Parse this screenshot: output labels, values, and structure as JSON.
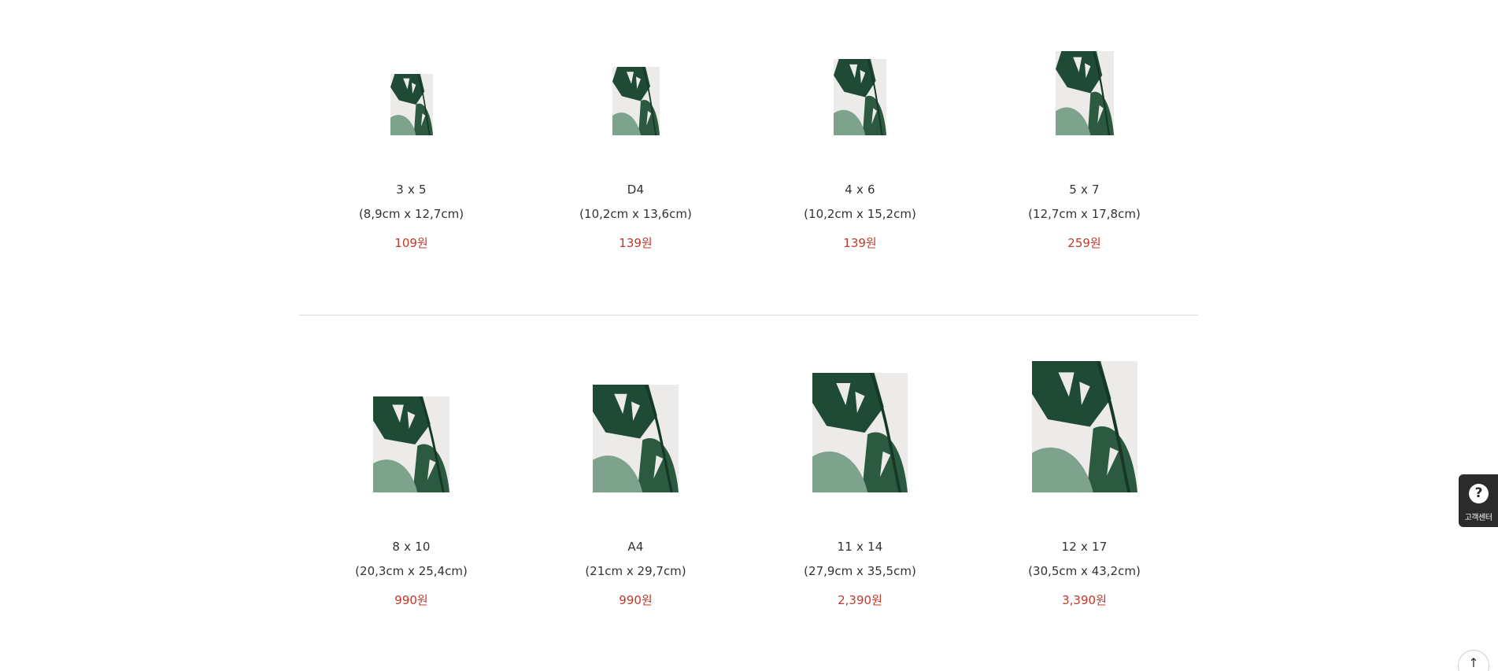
{
  "products_row1": [
    {
      "name": "3 x 5",
      "dimensions": "(8,9cm x 12,7cm)",
      "price": "109원"
    },
    {
      "name": "D4",
      "dimensions": "(10,2cm x 13,6cm)",
      "price": "139원"
    },
    {
      "name": "4 x 6",
      "dimensions": "(10,2cm x 15,2cm)",
      "price": "139원"
    },
    {
      "name": "5 x 7",
      "dimensions": "(12,7cm x 17,8cm)",
      "price": "259원"
    }
  ],
  "products_row2": [
    {
      "name": "8 x 10",
      "dimensions": "(20,3cm x 25,4cm)",
      "price": "990원"
    },
    {
      "name": "A4",
      "dimensions": "(21cm x 29,7cm)",
      "price": "990원"
    },
    {
      "name": "11 x 14",
      "dimensions": "(27,9cm x 35,5cm)",
      "price": "2,390원"
    },
    {
      "name": "12 x 17",
      "dimensions": "(30,5cm x 43,2cm)",
      "price": "3,390원"
    }
  ],
  "customer_center": {
    "icon": "question-icon",
    "symbol": "?",
    "label": "고객센터"
  },
  "scroll_top": {
    "icon": "arrow-up-icon",
    "symbol": "↑"
  },
  "colors": {
    "price": "#c0392b",
    "leaf_dark": "#1f4a36",
    "leaf_light": "#6f9a80",
    "photo_bg": "#ebeaea",
    "widget_bg": "#2b2b2b"
  }
}
